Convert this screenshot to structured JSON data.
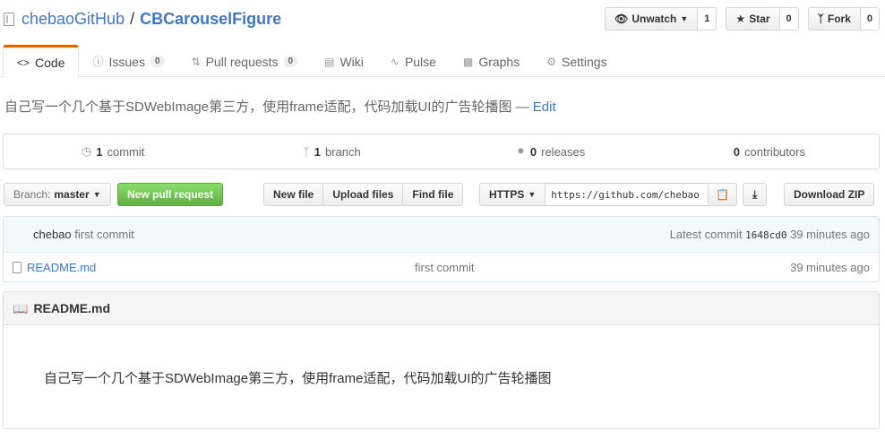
{
  "repo": {
    "owner": "chebaoGitHub",
    "separator": "/",
    "name": "CBCarouselFigure"
  },
  "actions": [
    {
      "label": "Unwatch",
      "count": "1",
      "icon": "eye-icon"
    },
    {
      "label": "Star",
      "count": "0",
      "icon": "star-icon"
    },
    {
      "label": "Fork",
      "count": "0",
      "icon": "fork-icon"
    }
  ],
  "tabs": [
    {
      "label": "Code",
      "icon": "code-icon",
      "selected": true
    },
    {
      "label": "Issues",
      "count": "0",
      "icon": "issue-icon"
    },
    {
      "label": "Pull requests",
      "count": "0",
      "icon": "pull-request-icon"
    },
    {
      "label": "Wiki",
      "icon": "book-icon"
    },
    {
      "label": "Pulse",
      "icon": "pulse-icon"
    },
    {
      "label": "Graphs",
      "icon": "graph-icon"
    },
    {
      "label": "Settings",
      "icon": "gear-icon"
    }
  ],
  "description": {
    "text": "自己写一个几个基于SDWebImage第三方，使用frame适配，代码加载UI的广告轮播图 —",
    "edit": "Edit"
  },
  "summary": {
    "commits": {
      "count": "1",
      "label": "commit"
    },
    "branches": {
      "count": "1",
      "label": "branch"
    },
    "releases": {
      "count": "0",
      "label": "releases"
    },
    "contributors": {
      "count": "0",
      "label": "contributors"
    }
  },
  "toolbar": {
    "branch_prefix": "Branch:",
    "branch_name": "master",
    "new_pr": "New pull request",
    "new_file": "New file",
    "upload_files": "Upload files",
    "find_file": "Find file",
    "protocol": "HTTPS",
    "clone_url": "https://github.com/chebao",
    "download_zip": "Download ZIP"
  },
  "commit_tease": {
    "author": "chebao",
    "message": "first commit",
    "latest_label": "Latest commit",
    "sha": "1648cd0",
    "age": "39 minutes ago"
  },
  "files": [
    {
      "name": "README.md",
      "message": "first commit",
      "age": "39 minutes ago"
    }
  ],
  "readme": {
    "title": "README.md",
    "content": "自己写一个几个基于SDWebImage第三方，使用frame适配，代码加载UI的广告轮播图"
  },
  "colors": {
    "link": "#4078c0",
    "tab_accent": "#d26911",
    "new_pr_green": "#60b044"
  }
}
